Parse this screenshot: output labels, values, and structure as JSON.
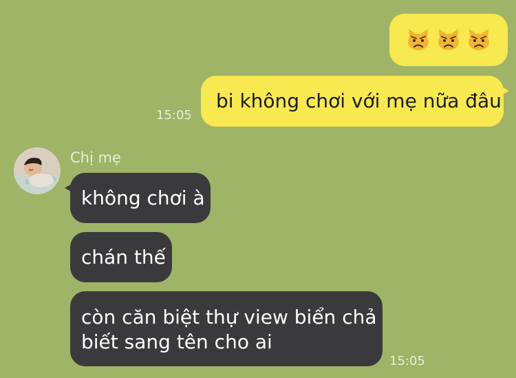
{
  "conversation": {
    "outgoing": {
      "emoji_reaction": {
        "icons": [
          "angry-cat-icon",
          "angry-cat-icon",
          "angry-cat-icon"
        ]
      },
      "message_text": "bi không chơi với mẹ nữa đâu",
      "timestamp": "15:05"
    },
    "incoming": {
      "sender_name": "Chị mẹ",
      "messages": [
        "không chơi à",
        "chán thế",
        "còn căn biệt thự view biển chả biết sang tên cho ai"
      ],
      "timestamp": "15:05"
    }
  },
  "colors": {
    "background": "#9fb466",
    "outgoing_bubble": "#f7e94f",
    "incoming_bubble": "#3a3a3c",
    "timestamp_text": "#e8edd9"
  }
}
